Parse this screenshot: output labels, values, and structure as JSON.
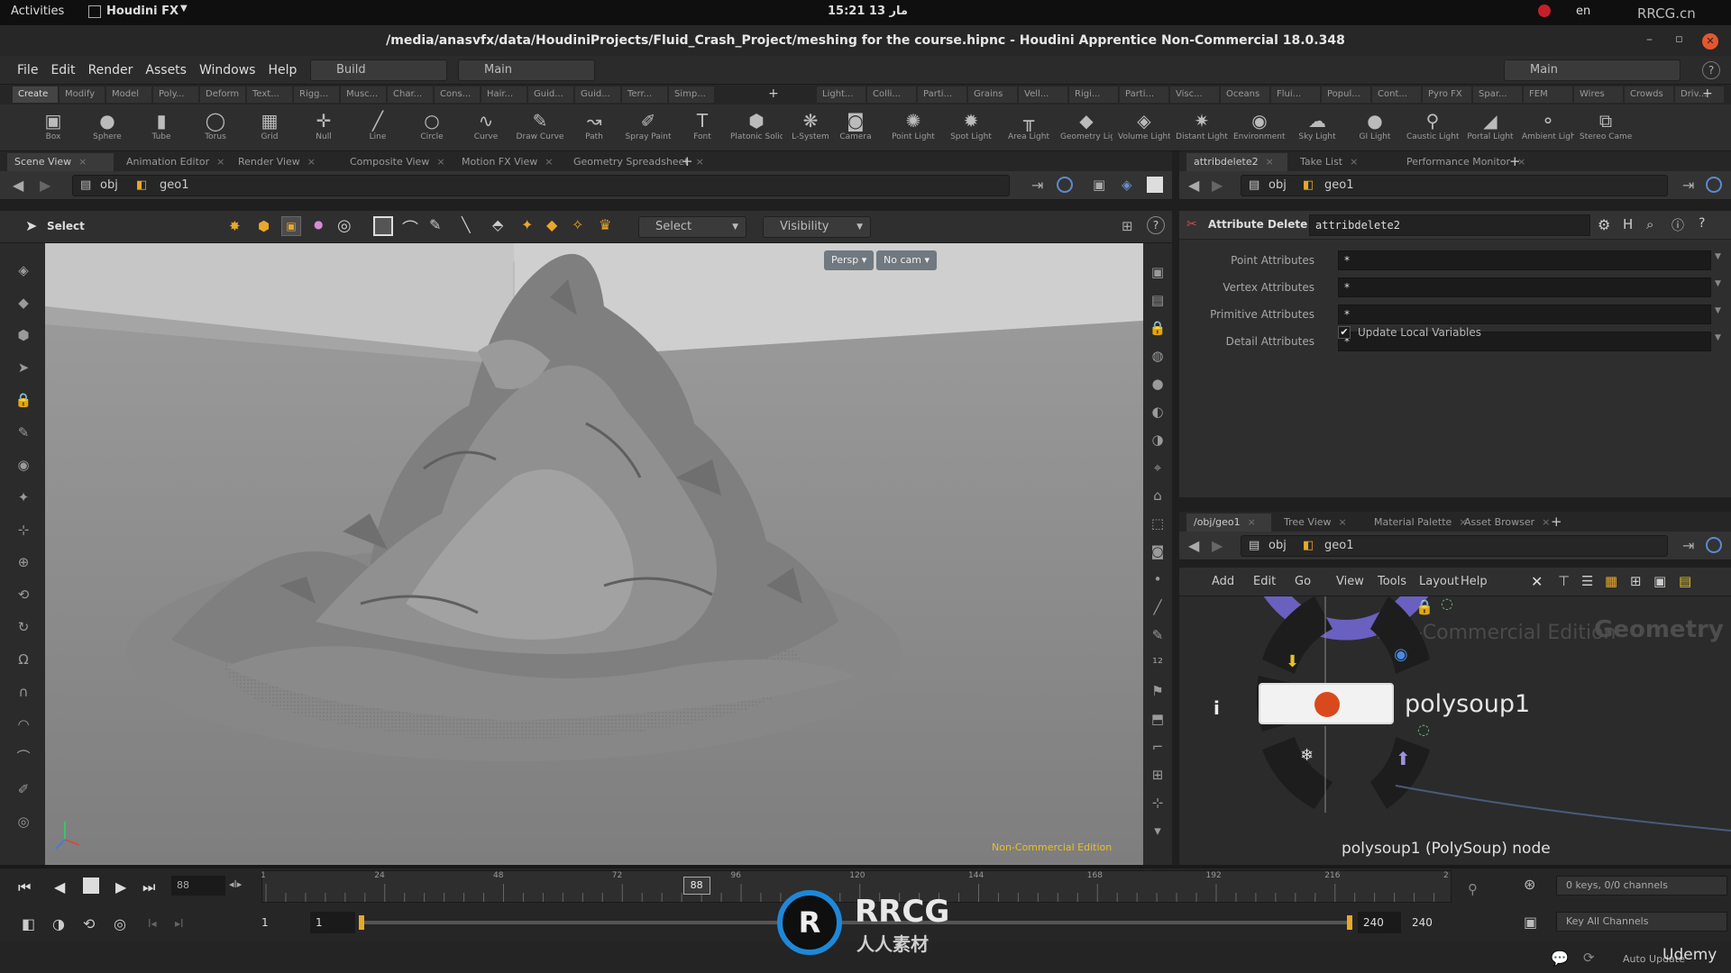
{
  "gnome": {
    "activities": "Activities",
    "app": "Houdini FX",
    "clock": "15:21  13 مار",
    "lang": "en",
    "watermark": "RRCG.cn"
  },
  "window": {
    "title": "/media/anasvfx/data/HoudiniProjects/Fluid_Crash_Project/meshing for the course.hipnc - Houdini Apprentice Non-Commercial 18.0.348"
  },
  "menu": [
    "File",
    "Edit",
    "Render",
    "Assets",
    "Windows",
    "Help"
  ],
  "desktop": {
    "build": "Build",
    "main": "Main",
    "main_right": "Main"
  },
  "shelf_tabs_left": [
    "Create",
    "Modify",
    "Model",
    "Poly...",
    "Deform",
    "Text...",
    "Rigg...",
    "Musc...",
    "Char...",
    "Cons...",
    "Hair...",
    "Guid...",
    "Guid...",
    "Terr...",
    "Simp..."
  ],
  "shelf_tabs_right": [
    "Light...",
    "Colli...",
    "Parti...",
    "Grains",
    "Vell...",
    "Rigi...",
    "Parti...",
    "Visc...",
    "Oceans",
    "Flui...",
    "Popul...",
    "Cont...",
    "Pyro FX",
    "Spar...",
    "FEM",
    "Wires",
    "Crowds",
    "Driv..."
  ],
  "tools_left": [
    {
      "icon": "▣",
      "label": "Box"
    },
    {
      "icon": "●",
      "label": "Sphere"
    },
    {
      "icon": "▮",
      "label": "Tube"
    },
    {
      "icon": "◯",
      "label": "Torus"
    },
    {
      "icon": "▦",
      "label": "Grid"
    },
    {
      "icon": "✛",
      "label": "Null"
    },
    {
      "icon": "╱",
      "label": "Line"
    },
    {
      "icon": "○",
      "label": "Circle"
    },
    {
      "icon": "∿",
      "label": "Curve"
    },
    {
      "icon": "✎",
      "label": "Draw Curve"
    },
    {
      "icon": "↝",
      "label": "Path"
    },
    {
      "icon": "✐",
      "label": "Spray Paint"
    },
    {
      "icon": "T",
      "label": "Font"
    },
    {
      "icon": "⬢",
      "label": "Platonic Solids"
    },
    {
      "icon": "❋",
      "label": "L-System"
    }
  ],
  "tools_right": [
    {
      "icon": "◙",
      "label": "Camera"
    },
    {
      "icon": "✺",
      "label": "Point Light"
    },
    {
      "icon": "✹",
      "label": "Spot Light"
    },
    {
      "icon": "╥",
      "label": "Area Light"
    },
    {
      "icon": "◆",
      "label": "Geometry Light"
    },
    {
      "icon": "◈",
      "label": "Volume Light"
    },
    {
      "icon": "✷",
      "label": "Distant Light"
    },
    {
      "icon": "◉",
      "label": "Environment Light"
    },
    {
      "icon": "☁",
      "label": "Sky Light"
    },
    {
      "icon": "●",
      "label": "GI Light"
    },
    {
      "icon": "⚲",
      "label": "Caustic Light"
    },
    {
      "icon": "◢",
      "label": "Portal Light"
    },
    {
      "icon": "⚬",
      "label": "Ambient Light"
    },
    {
      "icon": "⧉",
      "label": "Stereo Camera"
    }
  ],
  "left_tabs": [
    "Scene View",
    "Animation Editor",
    "Render View",
    "Composite View",
    "Motion FX View",
    "Geometry Spreadsheet"
  ],
  "right_top_tabs": [
    "attribdelete2",
    "Take List",
    "Performance Monitor"
  ],
  "right_bottom_tabs": [
    "/obj/geo1",
    "Tree View",
    "Material Palette",
    "Asset Browser"
  ],
  "path": {
    "obj": "obj",
    "geo": "geo1"
  },
  "viewtb": {
    "tool": "Select",
    "select_dd": "Select",
    "visibility_dd": "Visibility"
  },
  "viewport": {
    "persp": "Persp ▾",
    "cam": "No cam ▾",
    "edition": "Non-Commercial Edition"
  },
  "params": {
    "node_type": "Attribute Delete",
    "node_name": "attribdelete2",
    "rows": [
      {
        "label": "Point Attributes",
        "value": "*"
      },
      {
        "label": "Vertex Attributes",
        "value": "*"
      },
      {
        "label": "Primitive Attributes",
        "value": "*"
      },
      {
        "label": "Detail Attributes",
        "value": "*"
      }
    ],
    "update_local": "Update Local Variables",
    "update_checked": true
  },
  "network": {
    "menu": [
      "Add",
      "Edit",
      "Go",
      "View",
      "Tools",
      "Layout",
      "Help"
    ],
    "edition": "Non-Commercial Edition",
    "context": "Geometry",
    "node_name": "polysoup1",
    "node_desc": "polysoup1 (PolySoup) node"
  },
  "timeline": {
    "ticks": [
      "1",
      "24",
      "48",
      "72",
      "96",
      "120",
      "144",
      "168",
      "192",
      "216",
      "2"
    ],
    "current": "88",
    "frame_field": "88",
    "start": "1",
    "start2": "1",
    "end": "240",
    "end2": "240",
    "keys": "0 keys, 0/0 channels",
    "key_all": "Key All Channels",
    "auto_update": "Auto Update",
    "udemy": "Udemy"
  },
  "logo": {
    "text": "RRCG",
    "sub": "人人素材"
  },
  "colors": {
    "accent": "#e8a82a",
    "viewport_floor": "#8e8e8e",
    "sky": "#94a0ac"
  }
}
